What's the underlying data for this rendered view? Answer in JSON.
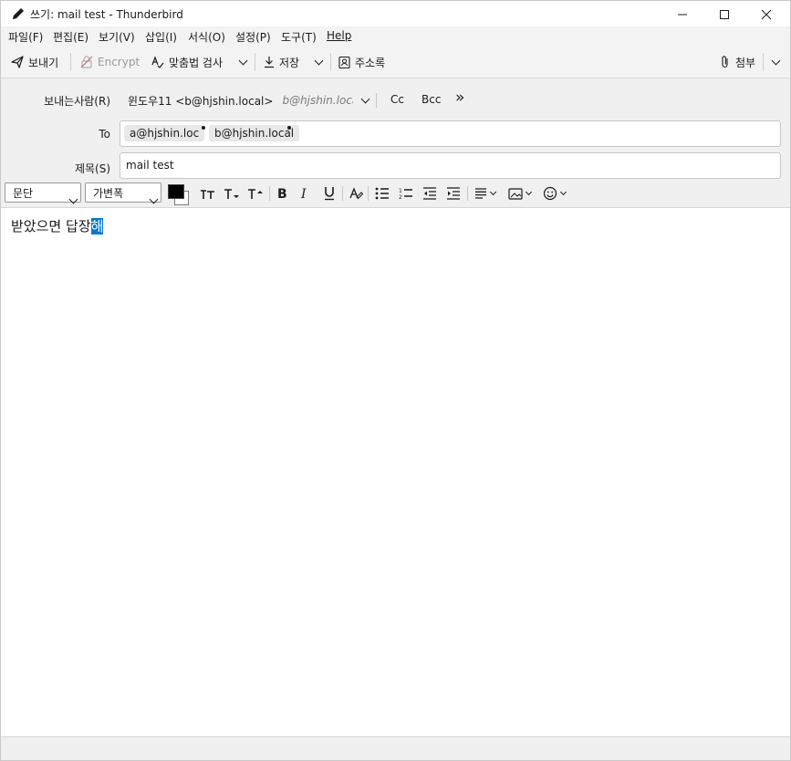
{
  "window": {
    "title": "쓰기: mail test - Thunderbird",
    "minimize_label": "—",
    "maximize_label": "☐",
    "close_label": "✕"
  },
  "menu": [
    "파일(F)",
    "편집(E)",
    "보기(V)",
    "삽입(I)",
    "서식(O)",
    "설정(P)",
    "도구(T)",
    "Help"
  ],
  "toolbar": {
    "send_label": "보내기",
    "encrypt_label": "Encrypt",
    "spellcheck_label": "맞춤법 검사",
    "save_label": "저장",
    "addressbook_label": "주소록",
    "attach_label": "첨부"
  },
  "compose": {
    "from_label": "보내는사람(R)",
    "from_name": "윈도우11 <b@hjshin.local>",
    "from_identity": "b@hjshin.local",
    "cc_label": "Cc",
    "bcc_label": "Bcc",
    "more_label": "»",
    "to_label": "To",
    "recipients": [
      "a@hjshin.loc",
      "b@hjshin.local"
    ],
    "subject_label": "제목(S)",
    "subject_value": "mail test"
  },
  "format": {
    "paragraph_value": "문단",
    "font_value": "가변폭",
    "text_color": "#000000",
    "bg_color": "#ffffff"
  },
  "body": {
    "text_before": "받았으면 답장",
    "text_selected": "해"
  },
  "colors": {
    "selection": "#0078d7",
    "chrome": "#f0f0f0",
    "encrypt_disabled": "#9a9a9a"
  }
}
